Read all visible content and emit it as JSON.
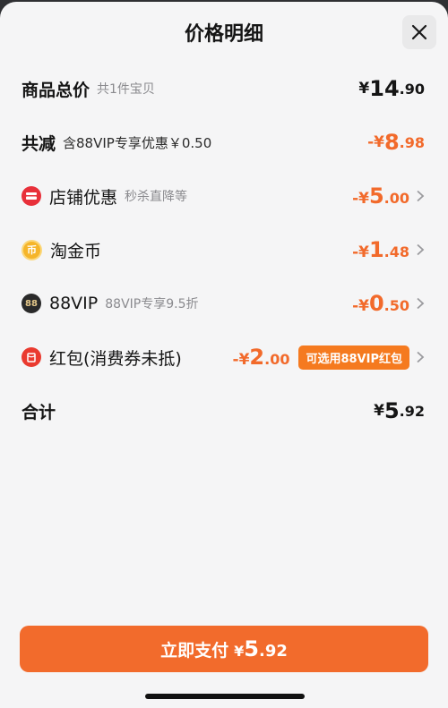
{
  "header": {
    "title": "价格明细"
  },
  "rows": {
    "total_goods": {
      "label": "商品总价",
      "sub": "共1件宝贝",
      "cur": "¥",
      "int": "14",
      "dec": ".90"
    },
    "discount_total": {
      "label": "共减",
      "sub": "含88VIP专享优惠￥0.50",
      "cur": "-¥",
      "int": "8",
      "dec": ".98"
    },
    "shop": {
      "label": "店铺优惠",
      "sub": "秒杀直降等",
      "cur": "-¥",
      "int": "5",
      "dec": ".00",
      "icon": "shop-coupon-icon"
    },
    "coin": {
      "label": "淘金币",
      "cur": "-¥",
      "int": "1",
      "dec": ".48",
      "icon": "coin-icon"
    },
    "vip": {
      "label": "88VIP",
      "sub": "88VIP专享9.5折",
      "cur": "-¥",
      "int": "0",
      "dec": ".50",
      "icon": "vip-88-icon"
    },
    "redpacket": {
      "label": "红包(消费券未抵)",
      "cur": "-¥",
      "int": "2",
      "dec": ".00",
      "badge": "可选用88VIP红包",
      "icon": "red-packet-icon"
    },
    "sum": {
      "label": "合计",
      "cur": "¥",
      "int": "5",
      "dec": ".92"
    }
  },
  "footer": {
    "pay_label": "立即支付",
    "cur": "¥",
    "int": "5",
    "dec": ".92"
  },
  "colors": {
    "accent": "#f26b2c",
    "badge": "#f57a1f",
    "text": "#151515",
    "muted": "#8a8a8e"
  }
}
